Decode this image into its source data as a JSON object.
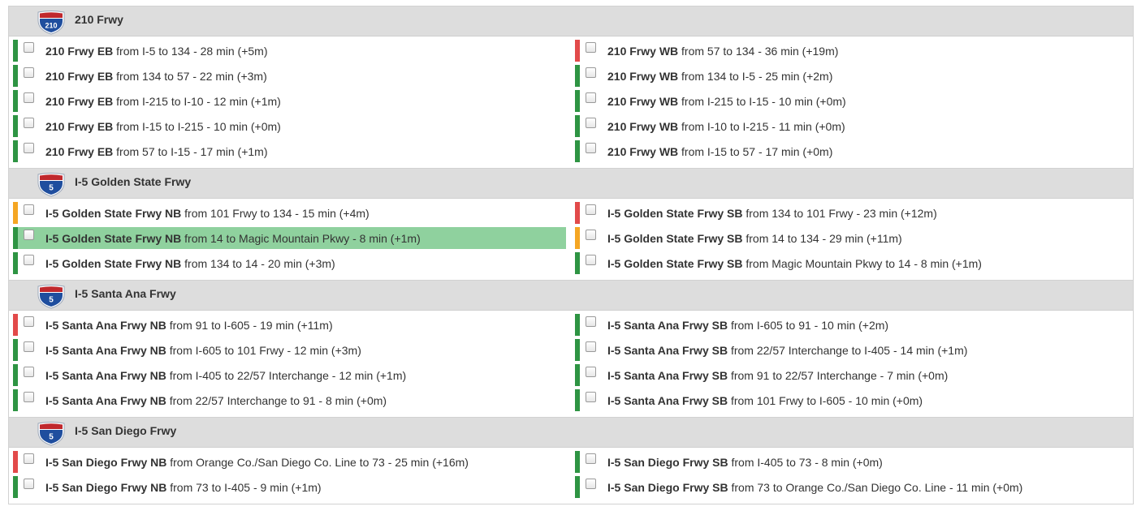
{
  "sections": [
    {
      "title": "210 Frwy",
      "shield": "210",
      "left": [
        {
          "route": "210 Frwy EB",
          "desc": "from I-5 to 134 - 28 min (+5m)",
          "status": "green"
        },
        {
          "route": "210 Frwy EB",
          "desc": "from 134 to 57 - 22 min (+3m)",
          "status": "green"
        },
        {
          "route": "210 Frwy EB",
          "desc": "from I-215 to I-10 - 12 min (+1m)",
          "status": "green"
        },
        {
          "route": "210 Frwy EB",
          "desc": "from I-15 to I-215 - 10 min (+0m)",
          "status": "green"
        },
        {
          "route": "210 Frwy EB",
          "desc": "from 57 to I-15 - 17 min (+1m)",
          "status": "green"
        }
      ],
      "right": [
        {
          "route": "210 Frwy WB",
          "desc": "from 57 to 134 - 36 min (+19m)",
          "status": "red"
        },
        {
          "route": "210 Frwy WB",
          "desc": "from 134 to I-5 - 25 min (+2m)",
          "status": "green"
        },
        {
          "route": "210 Frwy WB",
          "desc": "from I-215 to I-15 - 10 min (+0m)",
          "status": "green"
        },
        {
          "route": "210 Frwy WB",
          "desc": "from I-10 to I-215 - 11 min (+0m)",
          "status": "green"
        },
        {
          "route": "210 Frwy WB",
          "desc": "from I-15 to 57 - 17 min (+0m)",
          "status": "green"
        }
      ]
    },
    {
      "title": "I-5 Golden State Frwy",
      "shield": "5",
      "left": [
        {
          "route": "I-5 Golden State Frwy NB",
          "desc": "from 101 Frwy to 134 - 15 min (+4m)",
          "status": "orange"
        },
        {
          "route": "I-5 Golden State Frwy NB",
          "desc": "from 14 to Magic Mountain Pkwy - 8 min (+1m)",
          "status": "green",
          "highlight": true
        },
        {
          "route": "I-5 Golden State Frwy NB",
          "desc": "from 134 to 14 - 20 min (+3m)",
          "status": "green"
        }
      ],
      "right": [
        {
          "route": "I-5 Golden State Frwy SB",
          "desc": "from 134 to 101 Frwy - 23 min (+12m)",
          "status": "red"
        },
        {
          "route": "I-5 Golden State Frwy SB",
          "desc": "from 14 to 134 - 29 min (+11m)",
          "status": "orange"
        },
        {
          "route": "I-5 Golden State Frwy SB",
          "desc": "from Magic Mountain Pkwy to 14 - 8 min (+1m)",
          "status": "green"
        }
      ]
    },
    {
      "title": "I-5 Santa Ana Frwy",
      "shield": "5",
      "left": [
        {
          "route": "I-5 Santa Ana Frwy NB",
          "desc": "from 91 to I-605 - 19 min (+11m)",
          "status": "red"
        },
        {
          "route": "I-5 Santa Ana Frwy NB",
          "desc": "from I-605 to 101 Frwy - 12 min (+3m)",
          "status": "green"
        },
        {
          "route": "I-5 Santa Ana Frwy NB",
          "desc": "from I-405 to 22/57 Interchange - 12 min (+1m)",
          "status": "green"
        },
        {
          "route": "I-5 Santa Ana Frwy NB",
          "desc": "from 22/57 Interchange to 91 - 8 min (+0m)",
          "status": "green"
        }
      ],
      "right": [
        {
          "route": "I-5 Santa Ana Frwy SB",
          "desc": "from I-605 to 91 - 10 min (+2m)",
          "status": "green"
        },
        {
          "route": "I-5 Santa Ana Frwy SB",
          "desc": "from 22/57 Interchange to I-405 - 14 min (+1m)",
          "status": "green"
        },
        {
          "route": "I-5 Santa Ana Frwy SB",
          "desc": "from 91 to 22/57 Interchange - 7 min (+0m)",
          "status": "green"
        },
        {
          "route": "I-5 Santa Ana Frwy SB",
          "desc": "from 101 Frwy to I-605 - 10 min (+0m)",
          "status": "green"
        }
      ]
    },
    {
      "title": "I-5 San Diego Frwy",
      "shield": "5",
      "left": [
        {
          "route": "I-5 San Diego Frwy NB",
          "desc": "from Orange Co./San Diego Co. Line to 73 - 25 min (+16m)",
          "status": "red"
        },
        {
          "route": "I-5 San Diego Frwy NB",
          "desc": "from 73 to I-405 - 9 min (+1m)",
          "status": "green"
        }
      ],
      "right": [
        {
          "route": "I-5 San Diego Frwy SB",
          "desc": "from I-405 to 73 - 8 min (+0m)",
          "status": "green"
        },
        {
          "route": "I-5 San Diego Frwy SB",
          "desc": "from 73 to Orange Co./San Diego Co. Line - 11 min (+0m)",
          "status": "green"
        }
      ]
    }
  ],
  "colors": {
    "green": "#2e9443",
    "orange": "#f5a623",
    "red": "#e24a4a",
    "highlight": "#8fd19e",
    "shield_blue": "#1f4e9e",
    "shield_red": "#c0282d"
  }
}
